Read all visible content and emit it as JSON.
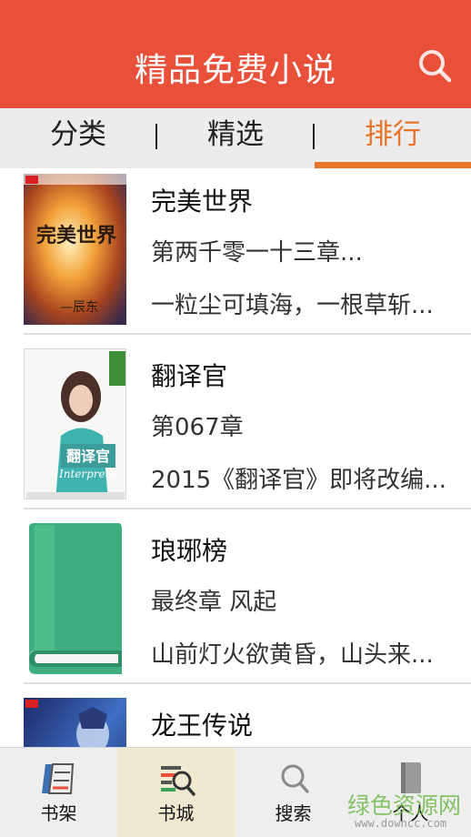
{
  "header": {
    "title": "精品免费小说",
    "search_icon": "search-icon"
  },
  "tabs": [
    {
      "label": "分类",
      "active": false
    },
    {
      "label": "精选",
      "active": false
    },
    {
      "label": "排行",
      "active": true
    }
  ],
  "books": [
    {
      "title": "完美世界",
      "line1": "第两千零一十三章...",
      "line2": "一粒尘可填海，一根草斩...",
      "cover_text": "完美世界",
      "cover_author": "—辰东"
    },
    {
      "title": "翻译官",
      "line1": "第067章",
      "line2": "2015《翻译官》即将改编...",
      "cover_text": "翻译官",
      "cover_subtext": "Interprete"
    },
    {
      "title": "琅琊榜",
      "line1": "最终章 风起",
      "line2": "山前灯火欲黄昏，山头来..."
    },
    {
      "title": "龙王传说",
      "line1": "",
      "line2": ""
    }
  ],
  "bottom_nav": [
    {
      "label": "书架",
      "icon": "bookshelf-icon",
      "active": false
    },
    {
      "label": "书城",
      "icon": "bookstore-icon",
      "active": true
    },
    {
      "label": "搜索",
      "icon": "search-icon",
      "active": false
    },
    {
      "label": "个人",
      "icon": "profile-icon",
      "active": false
    }
  ],
  "watermark": {
    "text": "绿色资源网",
    "url": "www.downcc.com"
  },
  "colors": {
    "primary": "#e8503a",
    "accent": "#e8732b",
    "tab_bg": "#ececec",
    "nav_active_bg": "#efe9cf"
  }
}
